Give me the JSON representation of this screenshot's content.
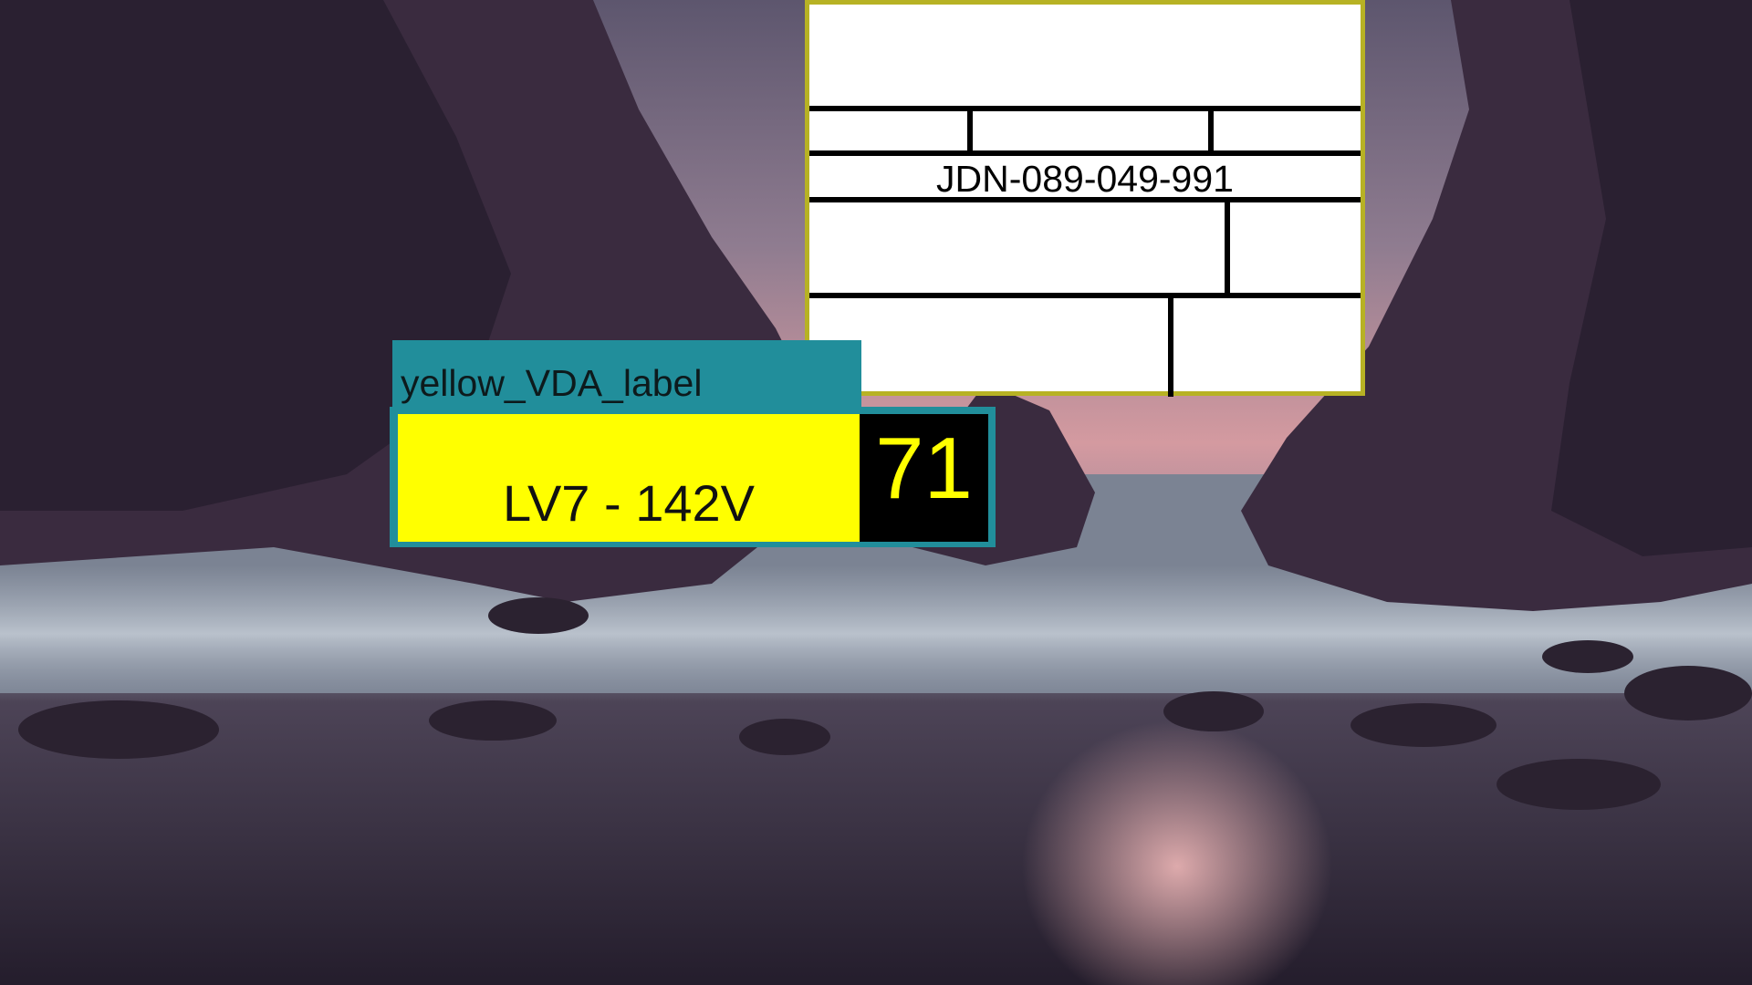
{
  "desktop": {
    "wallpaper": "sea-cave-at-dusk"
  },
  "doc_label": {
    "code": "JDN-089-049-991",
    "border_color": "#b7b224"
  },
  "vda_label": {
    "tag": "yellow_VDA_label",
    "text": "LV7 - 142V",
    "number": "71",
    "tag_color": "#218e9b",
    "label_color": "#ffff00"
  }
}
